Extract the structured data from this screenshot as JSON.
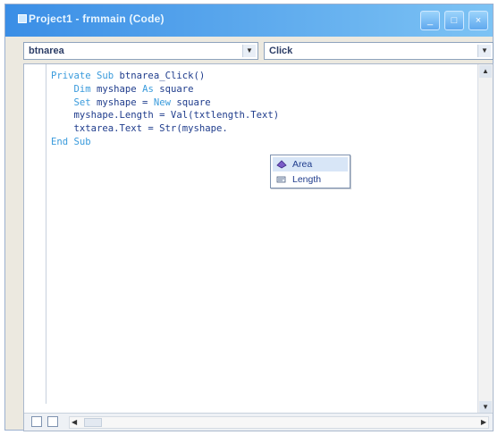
{
  "window": {
    "title": "Project1 - frmmain (Code)"
  },
  "combos": {
    "object": "btnarea",
    "procedure": "Click"
  },
  "code_lines": [
    [
      {
        "t": "Private Sub ",
        "kw": true
      },
      {
        "t": "btnarea_Click()",
        "kw": false
      }
    ],
    [
      {
        "t": "    ",
        "kw": false
      },
      {
        "t": "Dim ",
        "kw": true
      },
      {
        "t": "myshape ",
        "kw": false
      },
      {
        "t": "As ",
        "kw": true
      },
      {
        "t": "square",
        "kw": false
      }
    ],
    [
      {
        "t": "    ",
        "kw": false
      },
      {
        "t": "Set ",
        "kw": true
      },
      {
        "t": "myshape = ",
        "kw": false
      },
      {
        "t": "New ",
        "kw": true
      },
      {
        "t": "square",
        "kw": false
      }
    ],
    [
      {
        "t": "    myshape.Length = Val(txtlength.Text)",
        "kw": false
      }
    ],
    [
      {
        "t": "    txtarea.Text = Str(myshape.",
        "kw": false
      }
    ],
    [
      {
        "t": "End Sub",
        "kw": true
      }
    ]
  ],
  "autocomplete": {
    "items": [
      {
        "label": "Area",
        "icon": "method-icon",
        "selected": true
      },
      {
        "label": "Length",
        "icon": "property-icon",
        "selected": false
      }
    ]
  },
  "colors": {
    "titlebar": "#3a8ee6",
    "code": "#1f3c8c",
    "keyword": "#3a9bdc",
    "selection": "#d8e6f7"
  }
}
